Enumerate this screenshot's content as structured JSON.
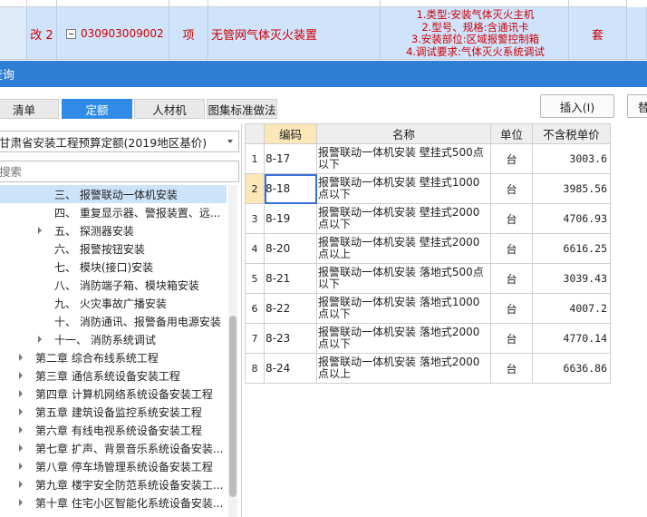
{
  "top_row": {
    "status": "改 2",
    "code": "030903009002",
    "unit": "项",
    "name": "无管网气体灭火装置",
    "features": [
      "1.类型:安装气体灭火主机",
      "2.型号、规格:含通讯卡",
      "3.安装部位:区域报警控制箱",
      "4.调试要求:气体灭火系统调试"
    ],
    "unit2": "套"
  },
  "dialog": {
    "title": "查询"
  },
  "tabs": [
    {
      "label": "清单",
      "active": false
    },
    {
      "label": "定额",
      "active": true
    },
    {
      "label": "人材机",
      "active": false
    },
    {
      "label": "图集标准做法",
      "active": false
    }
  ],
  "buttons": {
    "insert": "插入(I)",
    "replace": "替"
  },
  "library": {
    "selected": "甘肃省安装工程预算定额(2019地区基价)"
  },
  "search": {
    "placeholder": "搜索"
  },
  "tree": [
    {
      "label": "三、 报警联动一体机安装",
      "indent": 60,
      "expander": false,
      "selected": true
    },
    {
      "label": "四、 重复显示器、警报装置、远...",
      "indent": 60,
      "expander": false,
      "selected": false
    },
    {
      "label": "五、 探测器安装",
      "indent": 60,
      "expander": true,
      "selected": false
    },
    {
      "label": "六、 报警按钮安装",
      "indent": 60,
      "expander": false,
      "selected": false
    },
    {
      "label": "七、 模块(接口)安装",
      "indent": 60,
      "expander": false,
      "selected": false
    },
    {
      "label": "八、 消防端子箱、模块箱安装",
      "indent": 60,
      "expander": false,
      "selected": false
    },
    {
      "label": "九、 火灾事故广播安装",
      "indent": 60,
      "expander": false,
      "selected": false
    },
    {
      "label": "十、 消防通讯、报警备用电源安装",
      "indent": 60,
      "expander": false,
      "selected": false
    },
    {
      "label": "十一、 消防系统调试",
      "indent": 60,
      "expander": true,
      "selected": false
    },
    {
      "label": "第二章 综合布线系统工程",
      "indent": 39,
      "expander": true,
      "selected": false
    },
    {
      "label": "第三章 通信系统设备安装工程",
      "indent": 39,
      "expander": true,
      "selected": false
    },
    {
      "label": "第四章 计算机网络系统设备安装工程",
      "indent": 39,
      "expander": true,
      "selected": false
    },
    {
      "label": "第五章 建筑设备监控系统安装工程",
      "indent": 39,
      "expander": true,
      "selected": false
    },
    {
      "label": "第六章 有线电视系统设备安装工程",
      "indent": 39,
      "expander": true,
      "selected": false
    },
    {
      "label": "第七章 扩声、背景音乐系统设备安装...",
      "indent": 39,
      "expander": true,
      "selected": false
    },
    {
      "label": "第八章 停车场管理系统设备安装工程",
      "indent": 39,
      "expander": true,
      "selected": false
    },
    {
      "label": "第九章 楼宇安全防范系统设备安装工...",
      "indent": 39,
      "expander": true,
      "selected": false
    },
    {
      "label": "第十章 住宅小区智能化系统设备安装...",
      "indent": 39,
      "expander": true,
      "selected": false
    }
  ],
  "grid": {
    "headers": [
      "",
      "编码",
      "名称",
      "单位",
      "不含税单价"
    ],
    "rows": [
      {
        "n": "1",
        "code": "8-17",
        "name": "报警联动一体机安装 壁挂式500点以下",
        "unit": "台",
        "price": "3003.6",
        "selected": false
      },
      {
        "n": "2",
        "code": "8-18",
        "name": "报警联动一体机安装 壁挂式1000点以下",
        "unit": "台",
        "price": "3985.56",
        "selected": true
      },
      {
        "n": "3",
        "code": "8-19",
        "name": "报警联动一体机安装 壁挂式2000点以下",
        "unit": "台",
        "price": "4706.93",
        "selected": false
      },
      {
        "n": "4",
        "code": "8-20",
        "name": "报警联动一体机安装 壁挂式2000点以上",
        "unit": "台",
        "price": "6616.25",
        "selected": false
      },
      {
        "n": "5",
        "code": "8-21",
        "name": "报警联动一体机安装 落地式500点以下",
        "unit": "台",
        "price": "3039.43",
        "selected": false
      },
      {
        "n": "6",
        "code": "8-22",
        "name": "报警联动一体机安装 落地式1000点以下",
        "unit": "台",
        "price": "4007.2",
        "selected": false
      },
      {
        "n": "7",
        "code": "8-23",
        "name": "报警联动一体机安装 落地式2000点以下",
        "unit": "台",
        "price": "4770.14",
        "selected": false
      },
      {
        "n": "8",
        "code": "8-24",
        "name": "报警联动一体机安装 落地式2000点以上",
        "unit": "台",
        "price": "6636.86",
        "selected": false
      }
    ]
  },
  "colors": {
    "accent": "#2f7fd6",
    "tab_active": "#2f8be6",
    "row_highlight": "#cfe3fb",
    "sort_header": "#fbe7b8",
    "red_text": "#d00000"
  }
}
